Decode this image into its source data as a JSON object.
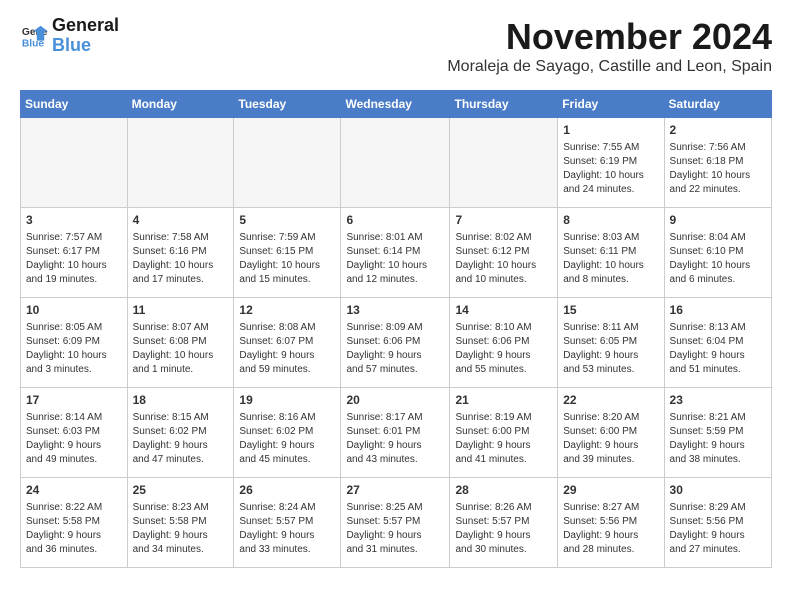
{
  "logo": {
    "line1": "General",
    "line2": "Blue"
  },
  "title": "November 2024",
  "location": "Moraleja de Sayago, Castille and Leon, Spain",
  "weekdays": [
    "Sunday",
    "Monday",
    "Tuesday",
    "Wednesday",
    "Thursday",
    "Friday",
    "Saturday"
  ],
  "weeks": [
    [
      {
        "day": "",
        "info": ""
      },
      {
        "day": "",
        "info": ""
      },
      {
        "day": "",
        "info": ""
      },
      {
        "day": "",
        "info": ""
      },
      {
        "day": "",
        "info": ""
      },
      {
        "day": "1",
        "info": "Sunrise: 7:55 AM\nSunset: 6:19 PM\nDaylight: 10 hours\nand 24 minutes."
      },
      {
        "day": "2",
        "info": "Sunrise: 7:56 AM\nSunset: 6:18 PM\nDaylight: 10 hours\nand 22 minutes."
      }
    ],
    [
      {
        "day": "3",
        "info": "Sunrise: 7:57 AM\nSunset: 6:17 PM\nDaylight: 10 hours\nand 19 minutes."
      },
      {
        "day": "4",
        "info": "Sunrise: 7:58 AM\nSunset: 6:16 PM\nDaylight: 10 hours\nand 17 minutes."
      },
      {
        "day": "5",
        "info": "Sunrise: 7:59 AM\nSunset: 6:15 PM\nDaylight: 10 hours\nand 15 minutes."
      },
      {
        "day": "6",
        "info": "Sunrise: 8:01 AM\nSunset: 6:14 PM\nDaylight: 10 hours\nand 12 minutes."
      },
      {
        "day": "7",
        "info": "Sunrise: 8:02 AM\nSunset: 6:12 PM\nDaylight: 10 hours\nand 10 minutes."
      },
      {
        "day": "8",
        "info": "Sunrise: 8:03 AM\nSunset: 6:11 PM\nDaylight: 10 hours\nand 8 minutes."
      },
      {
        "day": "9",
        "info": "Sunrise: 8:04 AM\nSunset: 6:10 PM\nDaylight: 10 hours\nand 6 minutes."
      }
    ],
    [
      {
        "day": "10",
        "info": "Sunrise: 8:05 AM\nSunset: 6:09 PM\nDaylight: 10 hours\nand 3 minutes."
      },
      {
        "day": "11",
        "info": "Sunrise: 8:07 AM\nSunset: 6:08 PM\nDaylight: 10 hours\nand 1 minute."
      },
      {
        "day": "12",
        "info": "Sunrise: 8:08 AM\nSunset: 6:07 PM\nDaylight: 9 hours\nand 59 minutes."
      },
      {
        "day": "13",
        "info": "Sunrise: 8:09 AM\nSunset: 6:06 PM\nDaylight: 9 hours\nand 57 minutes."
      },
      {
        "day": "14",
        "info": "Sunrise: 8:10 AM\nSunset: 6:06 PM\nDaylight: 9 hours\nand 55 minutes."
      },
      {
        "day": "15",
        "info": "Sunrise: 8:11 AM\nSunset: 6:05 PM\nDaylight: 9 hours\nand 53 minutes."
      },
      {
        "day": "16",
        "info": "Sunrise: 8:13 AM\nSunset: 6:04 PM\nDaylight: 9 hours\nand 51 minutes."
      }
    ],
    [
      {
        "day": "17",
        "info": "Sunrise: 8:14 AM\nSunset: 6:03 PM\nDaylight: 9 hours\nand 49 minutes."
      },
      {
        "day": "18",
        "info": "Sunrise: 8:15 AM\nSunset: 6:02 PM\nDaylight: 9 hours\nand 47 minutes."
      },
      {
        "day": "19",
        "info": "Sunrise: 8:16 AM\nSunset: 6:02 PM\nDaylight: 9 hours\nand 45 minutes."
      },
      {
        "day": "20",
        "info": "Sunrise: 8:17 AM\nSunset: 6:01 PM\nDaylight: 9 hours\nand 43 minutes."
      },
      {
        "day": "21",
        "info": "Sunrise: 8:19 AM\nSunset: 6:00 PM\nDaylight: 9 hours\nand 41 minutes."
      },
      {
        "day": "22",
        "info": "Sunrise: 8:20 AM\nSunset: 6:00 PM\nDaylight: 9 hours\nand 39 minutes."
      },
      {
        "day": "23",
        "info": "Sunrise: 8:21 AM\nSunset: 5:59 PM\nDaylight: 9 hours\nand 38 minutes."
      }
    ],
    [
      {
        "day": "24",
        "info": "Sunrise: 8:22 AM\nSunset: 5:58 PM\nDaylight: 9 hours\nand 36 minutes."
      },
      {
        "day": "25",
        "info": "Sunrise: 8:23 AM\nSunset: 5:58 PM\nDaylight: 9 hours\nand 34 minutes."
      },
      {
        "day": "26",
        "info": "Sunrise: 8:24 AM\nSunset: 5:57 PM\nDaylight: 9 hours\nand 33 minutes."
      },
      {
        "day": "27",
        "info": "Sunrise: 8:25 AM\nSunset: 5:57 PM\nDaylight: 9 hours\nand 31 minutes."
      },
      {
        "day": "28",
        "info": "Sunrise: 8:26 AM\nSunset: 5:57 PM\nDaylight: 9 hours\nand 30 minutes."
      },
      {
        "day": "29",
        "info": "Sunrise: 8:27 AM\nSunset: 5:56 PM\nDaylight: 9 hours\nand 28 minutes."
      },
      {
        "day": "30",
        "info": "Sunrise: 8:29 AM\nSunset: 5:56 PM\nDaylight: 9 hours\nand 27 minutes."
      }
    ]
  ]
}
